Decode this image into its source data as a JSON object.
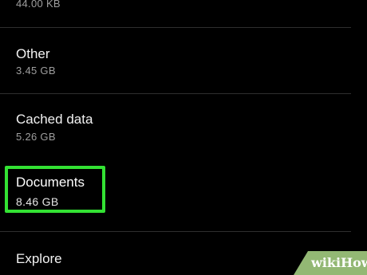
{
  "storage_list": {
    "items": [
      {
        "title": "",
        "size": "44.00 KB"
      },
      {
        "title": "Other",
        "size": "3.45 GB"
      },
      {
        "title": "Cached data",
        "size": "5.26 GB"
      },
      {
        "title": "Documents",
        "size": "8.46 GB"
      },
      {
        "title": "Explore",
        "size": ""
      }
    ]
  },
  "highlight": {
    "color": "#33e233",
    "target": "Documents"
  },
  "watermark": {
    "text_a": "wiki",
    "text_b": "How",
    "color": "#93b874"
  }
}
